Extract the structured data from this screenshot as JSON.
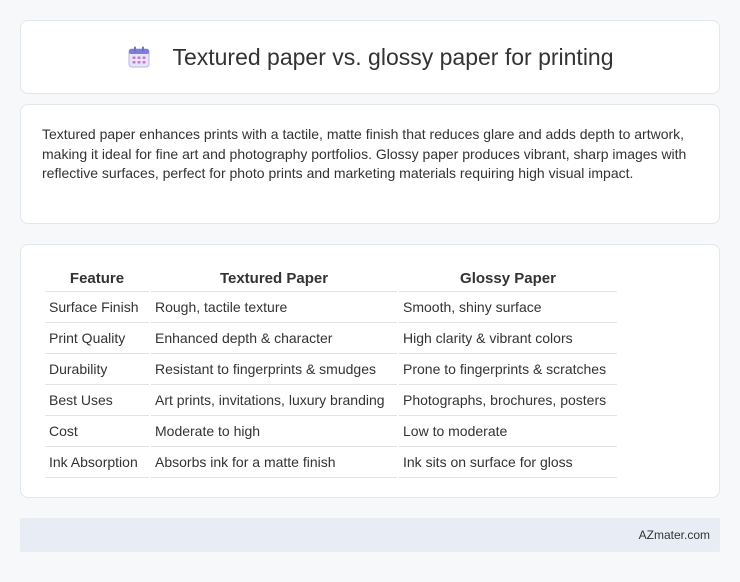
{
  "header": {
    "title": "Textured paper vs. glossy paper for printing",
    "icon": "calendar-icon",
    "icon_colors": {
      "top": "#7b7fd6",
      "body": "#e8e2f7",
      "dots": "#c07ad8"
    }
  },
  "description": "Textured paper enhances prints with a tactile, matte finish that reduces glare and adds depth to artwork, making it ideal for fine art and photography portfolios. Glossy paper produces vibrant, sharp images with reflective surfaces, perfect for photo prints and marketing materials requiring high visual impact.",
  "table": {
    "headers": [
      "Feature",
      "Textured Paper",
      "Glossy Paper"
    ],
    "rows": [
      [
        "Surface Finish",
        "Rough, tactile texture",
        "Smooth, shiny surface"
      ],
      [
        "Print Quality",
        "Enhanced depth & character",
        "High clarity & vibrant colors"
      ],
      [
        "Durability",
        "Resistant to fingerprints & smudges",
        "Prone to fingerprints & scratches"
      ],
      [
        "Best Uses",
        "Art prints, invitations, luxury branding",
        "Photographs, brochures, posters"
      ],
      [
        "Cost",
        "Moderate to high",
        "Low to moderate"
      ],
      [
        "Ink Absorption",
        "Absorbs ink for a matte finish",
        "Ink sits on surface for gloss"
      ]
    ]
  },
  "footer": {
    "brand": "AZmater.com"
  }
}
